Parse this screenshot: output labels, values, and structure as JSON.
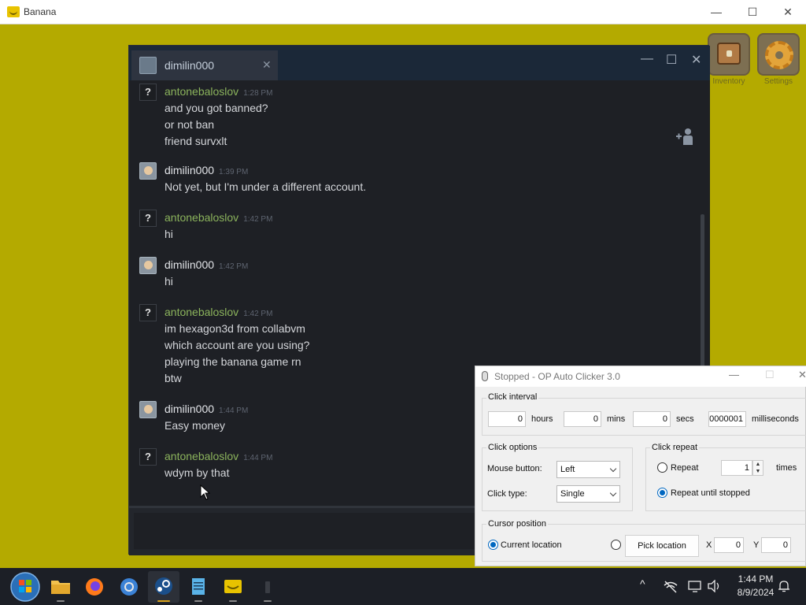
{
  "banana": {
    "title": "Banana",
    "min": "—",
    "max": "☐",
    "close": "✕",
    "inventory_label": "Inventory",
    "settings_label": "Settings"
  },
  "chat": {
    "tab_name": "dimilin000",
    "tab_close": "✕",
    "min": "—",
    "max": "☐",
    "close": "✕",
    "messages": [
      {
        "sender": "antonebaloslov",
        "time": "1:28 PM",
        "lines": [
          "and you got banned?",
          "or not ban",
          "friend survxlt"
        ]
      },
      {
        "sender": "dimilin000",
        "time": "1:39 PM",
        "lines": [
          "Not yet, but I'm under a different account."
        ]
      },
      {
        "sender": "antonebaloslov",
        "time": "1:42 PM",
        "lines": [
          "hi"
        ]
      },
      {
        "sender": "dimilin000",
        "time": "1:42 PM",
        "lines": [
          "hi"
        ]
      },
      {
        "sender": "antonebaloslov",
        "time": "1:42 PM",
        "lines": [
          "im hexagon3d from collabvm",
          "which account are you using?",
          "playing the banana game rn",
          "btw"
        ]
      },
      {
        "sender": "dimilin000",
        "time": "1:44 PM",
        "lines": [
          "Easy money"
        ]
      },
      {
        "sender": "antonebaloslov",
        "time": "1:44 PM",
        "lines": [
          "wdym by that"
        ]
      }
    ]
  },
  "autoclicker": {
    "title": "Stopped - OP Auto Clicker 3.0",
    "min": "—",
    "max": "☐",
    "close": "✕",
    "interval": {
      "legend": "Click interval",
      "hours": "0",
      "hours_label": "hours",
      "mins": "0",
      "mins_label": "mins",
      "secs": "0",
      "secs_label": "secs",
      "ms": "0000001",
      "ms_label": "milliseconds"
    },
    "options": {
      "legend": "Click options",
      "mouse_button_label": "Mouse button:",
      "mouse_button_value": "Left",
      "click_type_label": "Click type:",
      "click_type_value": "Single"
    },
    "repeat": {
      "legend": "Click repeat",
      "repeat_label": "Repeat",
      "repeat_count": "1",
      "times_label": "times",
      "until_stopped_label": "Repeat until stopped"
    },
    "cursor": {
      "legend": "Cursor position",
      "current_label": "Current location",
      "pick_label": "Pick location",
      "x_label": "X",
      "x_value": "0",
      "y_label": "Y",
      "y_value": "0"
    }
  },
  "taskbar": {
    "time": "1:44 PM",
    "date": "8/9/2024",
    "tray_chevron": "^"
  }
}
